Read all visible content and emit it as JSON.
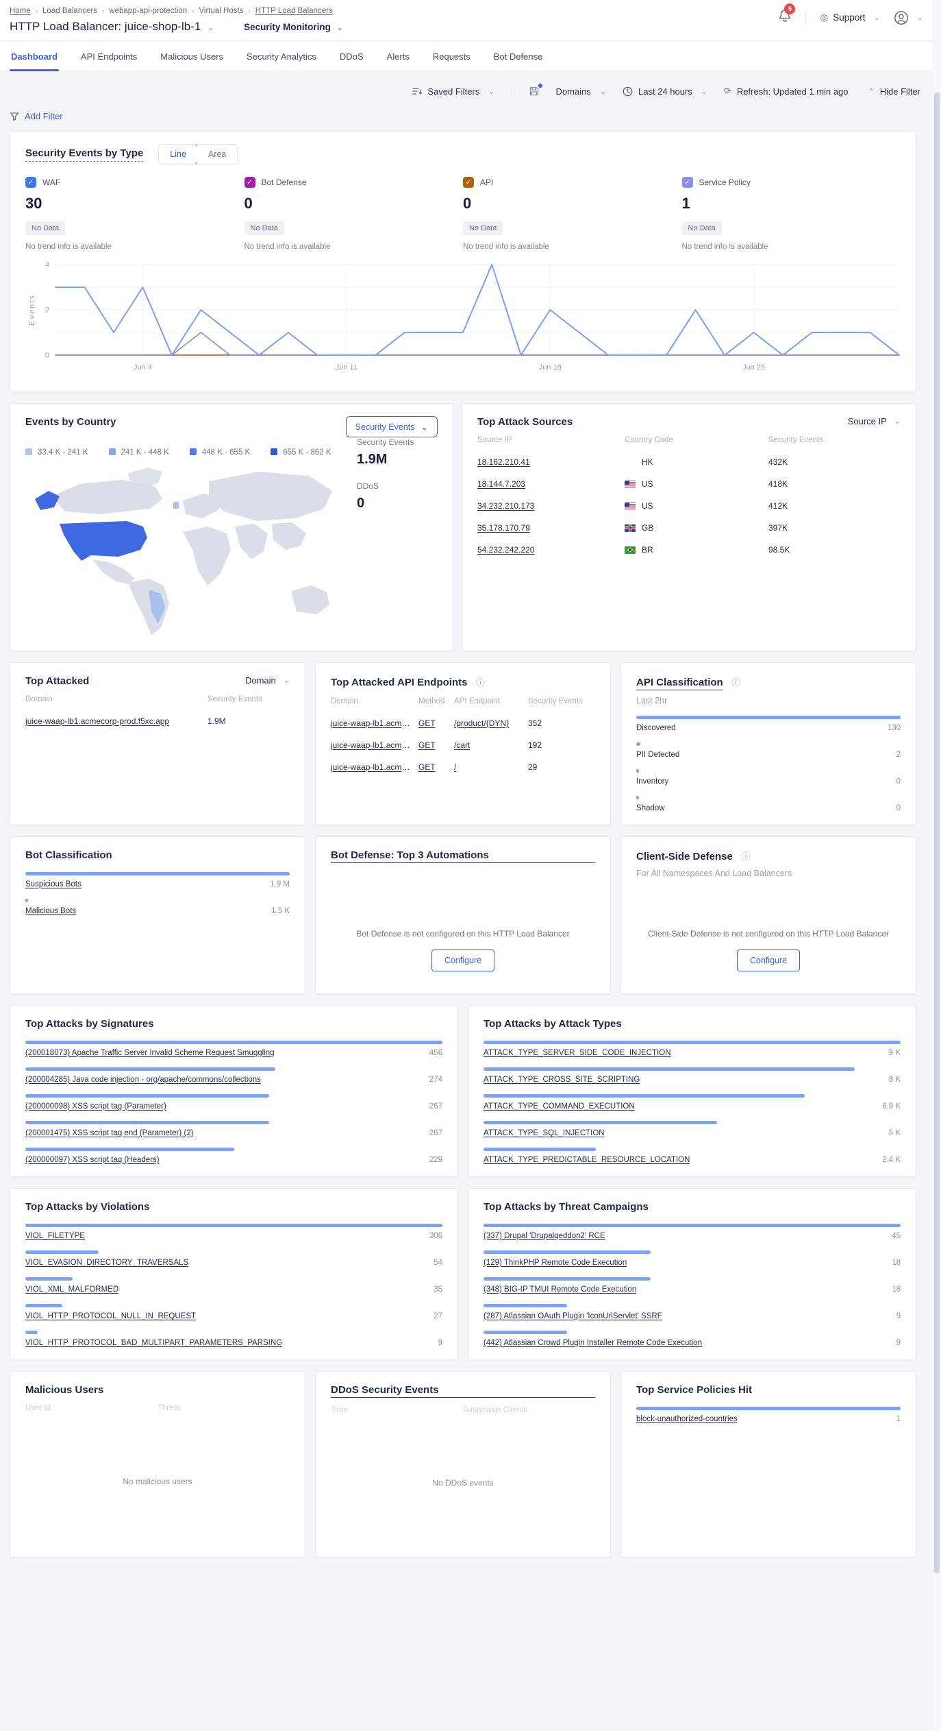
{
  "header": {
    "breadcrumbs": [
      {
        "label": "Home",
        "style": "link"
      },
      {
        "label": "Load Balancers",
        "style": "plain"
      },
      {
        "label": "webapp-api-protection",
        "style": "plain"
      },
      {
        "label": "Virtual Hosts",
        "style": "plain"
      },
      {
        "label": "HTTP Load Balancers",
        "style": "link"
      }
    ],
    "title": "HTTP Load Balancer: juice-shop-lb-1",
    "context_menu": "Security Monitoring",
    "notification_count": "5",
    "support_label": "Support"
  },
  "tabs": [
    {
      "label": "Dashboard",
      "state": "active"
    },
    {
      "label": "API Endpoints",
      "state": ""
    },
    {
      "label": "Malicious Users",
      "state": ""
    },
    {
      "label": "Security Analytics",
      "state": ""
    },
    {
      "label": "DDoS",
      "state": ""
    },
    {
      "label": "Alerts",
      "state": ""
    },
    {
      "label": "Requests",
      "state": ""
    },
    {
      "label": "Bot Defense",
      "state": ""
    }
  ],
  "filter_bar": {
    "saved_filters": "Saved Filters",
    "domains": "Domains",
    "time_range": "Last 24 hours",
    "refresh": "Refresh: Updated 1 min ago",
    "hide_filter": "Hide Filter",
    "add_filter": "Add Filter"
  },
  "security_events": {
    "title": "Security Events by Type",
    "toggles": [
      {
        "label": "Line",
        "state": "active"
      },
      {
        "label": "Area",
        "state": ""
      }
    ],
    "stats": [
      {
        "label": "WAF",
        "value": "30",
        "color": "#3C78F0",
        "check": "✓",
        "badge": "No Data",
        "trend": "No trend info is available"
      },
      {
        "label": "Bot Defense",
        "value": "0",
        "color": "#A81CB4",
        "check": "✓",
        "badge": "No Data",
        "trend": "No trend info is available"
      },
      {
        "label": "API",
        "value": "0",
        "color": "#B36005",
        "check": "✓",
        "badge": "No Data",
        "trend": "No trend info is available"
      },
      {
        "label": "Service Policy",
        "value": "1",
        "color": "#8A90F2",
        "check": "✓",
        "badge": "No Data",
        "trend": "No trend info is available"
      }
    ],
    "chart_data": {
      "type": "line",
      "ylabel": "Events",
      "ylim": [
        0,
        4
      ],
      "yticks": [
        0,
        2,
        4
      ],
      "grid": true,
      "n_points": 30,
      "x_labels": [
        "Jun 4",
        "Jun 11",
        "Jun 18",
        "Jun 25"
      ],
      "x_label_positions": [
        3,
        10,
        17,
        24
      ],
      "series": [
        {
          "name": "Bot Defense",
          "color": "#AC4A55",
          "values": [
            0,
            0,
            0,
            0,
            0,
            0,
            0,
            0,
            0,
            0,
            0,
            0,
            0,
            0,
            0,
            0,
            0,
            0,
            0,
            0,
            0,
            0,
            0,
            0,
            0,
            0,
            0,
            0,
            0,
            0
          ]
        },
        {
          "name": "API",
          "color": "#C06A2C",
          "values": [
            null,
            null,
            null,
            0,
            0,
            0,
            0,
            null,
            null,
            null,
            null,
            null,
            null,
            null,
            null,
            null,
            null,
            null,
            null,
            null,
            null,
            null,
            null,
            null,
            null,
            null,
            null,
            null,
            null,
            null
          ]
        },
        {
          "name": "Service Policy",
          "color": "#9186CE",
          "values": [
            0,
            0,
            0,
            0,
            0,
            1,
            0,
            0,
            0,
            0,
            0,
            0,
            0,
            0,
            0,
            0,
            0,
            0,
            0,
            0,
            0,
            0,
            0,
            0,
            0,
            0,
            0,
            0,
            0,
            0
          ]
        },
        {
          "name": "WAF",
          "color": "#77A0F2",
          "width": 2,
          "values": [
            3,
            3,
            1,
            3,
            0,
            2,
            1,
            0,
            1,
            0,
            0,
            0,
            1,
            1,
            1,
            4,
            0,
            2,
            1,
            0,
            0,
            0,
            2,
            0,
            1,
            0,
            1,
            1,
            1,
            0
          ]
        }
      ]
    }
  },
  "events_by_country": {
    "title": "Events by Country",
    "dropdown_label": "Security Events",
    "legend": [
      {
        "range": "33.4 K - 241 K",
        "color": "#B3C4E9"
      },
      {
        "range": "241 K - 448 K",
        "color": "#84A6EF"
      },
      {
        "range": "448 K - 655 K",
        "color": "#4D7BF3"
      },
      {
        "range": "655 K - 862 K",
        "color": "#2458E5"
      }
    ],
    "stats": [
      {
        "label": "Security Events",
        "value": "1.9M"
      },
      {
        "label": "DDoS",
        "value": "0"
      }
    ]
  },
  "top_attack_sources": {
    "title": "Top Attack Sources",
    "dropdown_label": "Source IP",
    "columns": [
      "Source IP",
      "Country Code",
      "Security Events"
    ],
    "rows": [
      {
        "ip": "18.162.210.41",
        "flag": "none",
        "cc": "HK",
        "events": "432K"
      },
      {
        "ip": "18.144.7.203",
        "flag": "us",
        "cc": "US",
        "events": "418K"
      },
      {
        "ip": "34.232.210.173",
        "flag": "us",
        "cc": "US",
        "events": "412K"
      },
      {
        "ip": "35.178.170.79",
        "flag": "gb",
        "cc": "GB",
        "events": "397K"
      },
      {
        "ip": "54.232.242.220",
        "flag": "br",
        "cc": "BR",
        "events": "98.5K"
      }
    ]
  },
  "top_attacked": {
    "title": "Top Attacked",
    "dropdown_label": "Domain",
    "columns": [
      "Domain",
      "Security Events"
    ],
    "rows": [
      {
        "domain": "juice-waap-lb1.acmecorp-prod.f5xc.app",
        "events": "1.9M"
      }
    ]
  },
  "top_attacked_api": {
    "title": "Top Attacked API Endpoints",
    "columns": [
      "Domain",
      "Method",
      "API Endpoint",
      "Security Events"
    ],
    "rows": [
      {
        "domain": "juice-waap-lb1.acmecorp-p...",
        "method": "GET",
        "endpoint": "/product/{DYN}",
        "events": "352"
      },
      {
        "domain": "juice-waap-lb1.acmecorp-p...",
        "method": "GET",
        "endpoint": "/cart",
        "events": "192"
      },
      {
        "domain": "juice-waap-lb1.acmecorp-p...",
        "method": "GET",
        "endpoint": "/",
        "events": "29"
      }
    ]
  },
  "api_classification": {
    "title": "API Classification",
    "subtitle": "Last 2hr",
    "rows": [
      {
        "label": "Discovered",
        "value": "130",
        "bar_pct": 100
      },
      {
        "label": "PII Detected",
        "value": "2",
        "bar_pct": 1.6
      },
      {
        "label": "Inventory",
        "value": "0",
        "bar_pct": 0.5
      },
      {
        "label": "Shadow",
        "value": "0",
        "bar_pct": 0.5
      }
    ]
  },
  "bot_classification": {
    "title": "Bot Classification",
    "rows": [
      {
        "label": "Suspicious Bots",
        "value": "1.9 M",
        "bar_pct": 100
      },
      {
        "label": "Malicious Bots",
        "value": "1.5 K",
        "bar_pct": 0.8
      }
    ]
  },
  "bot_defense": {
    "title": "Bot Defense: Top 3 Automations",
    "empty": "Bot Defense is not configured on this HTTP Load Balancer",
    "button": "Configure"
  },
  "client_side_defense": {
    "title": "Client-Side Defense",
    "subtitle": "For All Namespaces And Load Balancers",
    "empty": "Client-Side Defense is not configured on this HTTP Load Balancer",
    "button": "Configure"
  },
  "top_signatures": {
    "title": "Top Attacks by Signatures",
    "rows": [
      {
        "label": "(200018073) Apache Traffic Server Invalid Scheme Request Smuggling",
        "value": "456",
        "bar_pct": 100
      },
      {
        "label": "(200004285) Java code injection - org/apache/commons/collections",
        "value": "274",
        "bar_pct": 60
      },
      {
        "label": "(200000098) XSS script tag (Parameter)",
        "value": "267",
        "bar_pct": 58.5
      },
      {
        "label": "(200001475) XSS script tag end (Parameter) (2)",
        "value": "267",
        "bar_pct": 58.5
      },
      {
        "label": "(200000097) XSS script tag (Headers)",
        "value": "229",
        "bar_pct": 50
      }
    ]
  },
  "top_attack_types": {
    "title": "Top Attacks by Attack Types",
    "rows": [
      {
        "label": "ATTACK_TYPE_SERVER_SIDE_CODE_INJECTION",
        "value": "9 K",
        "bar_pct": 100
      },
      {
        "label": "ATTACK_TYPE_CROSS_SITE_SCRIPTING",
        "value": "8 K",
        "bar_pct": 89
      },
      {
        "label": "ATTACK_TYPE_COMMAND_EXECUTION",
        "value": "6.9 K",
        "bar_pct": 77
      },
      {
        "label": "ATTACK_TYPE_SQL_INJECTION",
        "value": "5 K",
        "bar_pct": 56
      },
      {
        "label": "ATTACK_TYPE_PREDICTABLE_RESOURCE_LOCATION",
        "value": "2.4 K",
        "bar_pct": 27
      }
    ]
  },
  "top_violations": {
    "title": "Top Attacks by Violations",
    "rows": [
      {
        "label": "VIOL_FILETYPE",
        "value": "306",
        "bar_pct": 100
      },
      {
        "label": "VIOL_EVASION_DIRECTORY_TRAVERSALS",
        "value": "54",
        "bar_pct": 17.6
      },
      {
        "label": "VIOL_XML_MALFORMED",
        "value": "35",
        "bar_pct": 11.4
      },
      {
        "label": "VIOL_HTTP_PROTOCOL_NULL_IN_REQUEST",
        "value": "27",
        "bar_pct": 8.8
      },
      {
        "label": "VIOL_HTTP_PROTOCOL_BAD_MULTIPART_PARAMETERS_PARSING",
        "value": "9",
        "bar_pct": 2.9
      }
    ]
  },
  "top_threat_campaigns": {
    "title": "Top Attacks by Threat Campaigns",
    "rows": [
      {
        "label": "(337) Drupal 'Drupalgeddon2' RCE",
        "value": "45",
        "bar_pct": 100
      },
      {
        "label": "(129) ThinkPHP Remote Code Execution",
        "value": "18",
        "bar_pct": 40
      },
      {
        "label": "(348) BIG-IP TMUI Remote Code Execution",
        "value": "18",
        "bar_pct": 40
      },
      {
        "label": "(287) Atlassian OAuth Plugin 'IconUriServlet' SSRF",
        "value": "9",
        "bar_pct": 20
      },
      {
        "label": "(442) Atlassian Crowd Plugin Installer Remote Code Execution",
        "value": "9",
        "bar_pct": 20
      }
    ]
  },
  "malicious_users": {
    "title": "Malicious Users",
    "columns": [
      "User Id",
      "Threat"
    ],
    "empty": "No malicious users"
  },
  "ddos_events": {
    "title": "DDoS Security Events",
    "columns": [
      "Time",
      "Suspicious Clients"
    ],
    "empty": "No DDoS events"
  },
  "top_service_policies": {
    "title": "Top Service Policies Hit",
    "rows": [
      {
        "label": "block-unauthorized-countries",
        "value": "1",
        "bar_pct": 100
      }
    ]
  }
}
